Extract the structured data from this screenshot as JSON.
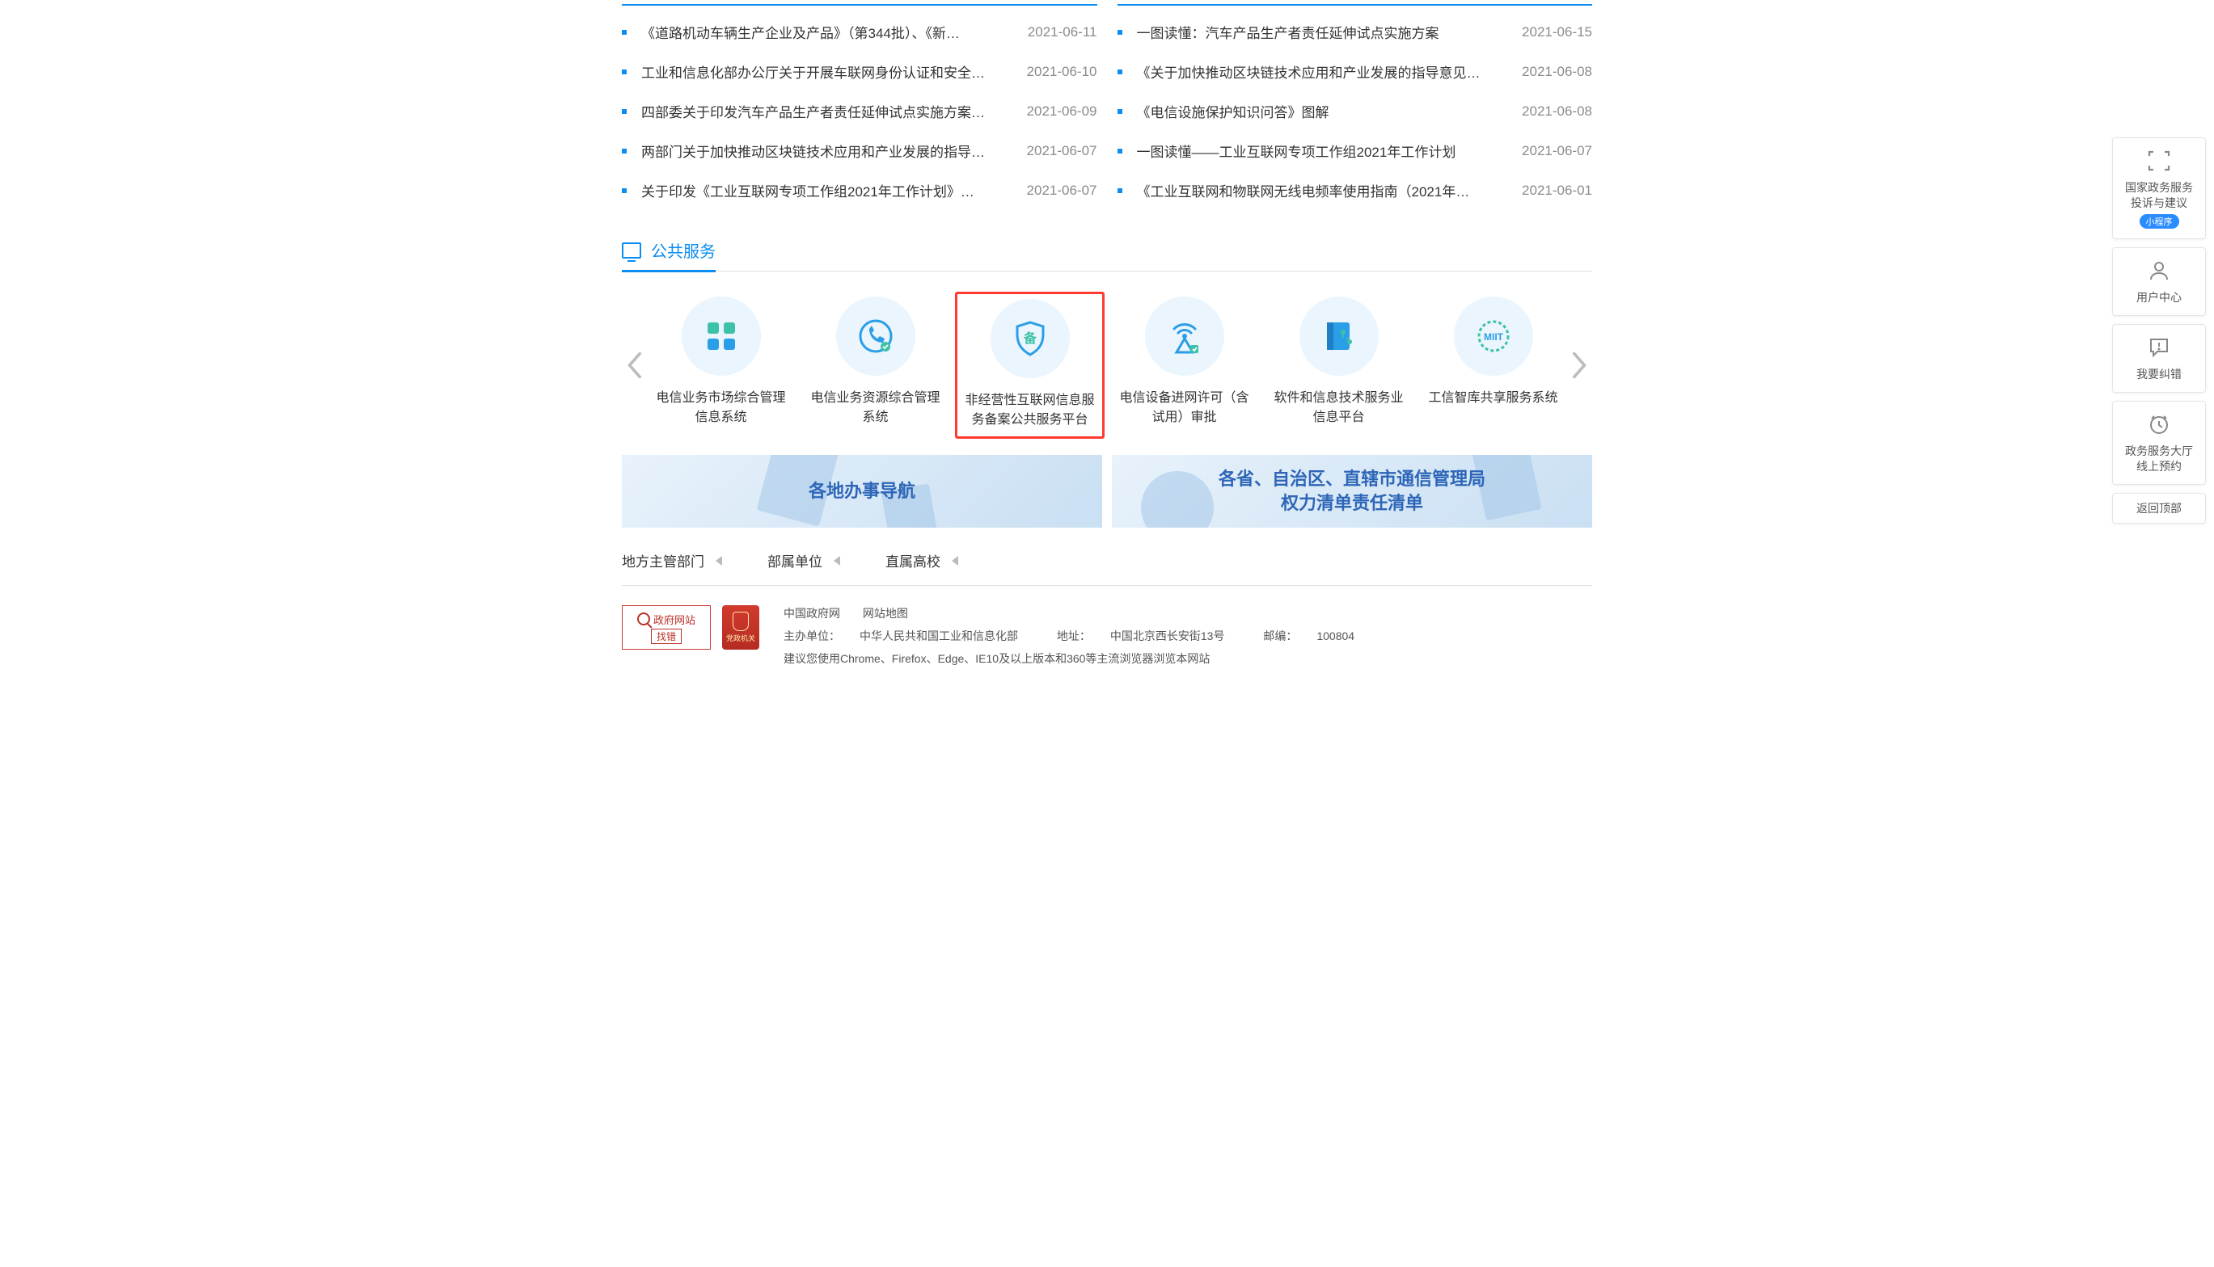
{
  "newsLeft": [
    {
      "title": "《道路机动车辆生产企业及产品》（第344批）、《新…",
      "date": "2021-06-11"
    },
    {
      "title": "工业和信息化部办公厅关于开展车联网身份认证和安全…",
      "date": "2021-06-10"
    },
    {
      "title": "四部委关于印发汽车产品生产者责任延伸试点实施方案…",
      "date": "2021-06-09"
    },
    {
      "title": "两部门关于加快推动区块链技术应用和产业发展的指导…",
      "date": "2021-06-07"
    },
    {
      "title": "关于印发《工业互联网专项工作组2021年工作计划》…",
      "date": "2021-06-07"
    }
  ],
  "newsRight": [
    {
      "title": "一图读懂：汽车产品生产者责任延伸试点实施方案",
      "date": "2021-06-15"
    },
    {
      "title": "《关于加快推动区块链技术应用和产业发展的指导意见…",
      "date": "2021-06-08"
    },
    {
      "title": "《电信设施保护知识问答》图解",
      "date": "2021-06-08"
    },
    {
      "title": "一图读懂——工业互联网专项工作组2021年工作计划",
      "date": "2021-06-07"
    },
    {
      "title": "《工业互联网和物联网无线电频率使用指南（2021年…",
      "date": "2021-06-01"
    }
  ],
  "section": {
    "publicService": "公共服务"
  },
  "services": [
    {
      "label": "电信业务市场综合管理\n信息系统",
      "icon": "grid"
    },
    {
      "label": "电信业务资源综合管理\n系统",
      "icon": "phone"
    },
    {
      "label": "非经营性互联网信息服\n务备案公共服务平台",
      "icon": "shield",
      "highlight": true
    },
    {
      "label": "电信设备进网许可（含\n试用）审批",
      "icon": "antenna"
    },
    {
      "label": "软件和信息技术服务业\n信息平台",
      "icon": "book"
    },
    {
      "label": "工信智库共享服务系统",
      "icon": "miit"
    }
  ],
  "banners": {
    "left": "各地办事导航",
    "right": "各省、自治区、直辖市通信管理局\n权力清单责任清单"
  },
  "bottomLinks": [
    "地方主管部门",
    "部属单位",
    "直属高校"
  ],
  "footer": {
    "badge_top": "政府网站",
    "badge_bottom": "找错",
    "badge_party": "党政机关",
    "links": {
      "gov": "中国政府网",
      "sitemap": "网站地图"
    },
    "host": {
      "label": "主办单位：",
      "value": "中华人民共和国工业和信息化部",
      "addrLabel": "地址：",
      "addr": "中国北京西长安街13号",
      "zipLabel": "邮编：",
      "zip": "100804"
    },
    "browser": "建议您使用Chrome、Firefox、Edge、IE10及以上版本和360等主流浏览器浏览本网站"
  },
  "side": {
    "complaint": {
      "line1": "国家政务服务",
      "line2": "投诉与建议",
      "pill": "小程序"
    },
    "user": "用户中心",
    "correct": "我要纠错",
    "appoint": {
      "line1": "政务服务大厅",
      "line2": "线上预约"
    },
    "top": "返回顶部"
  }
}
